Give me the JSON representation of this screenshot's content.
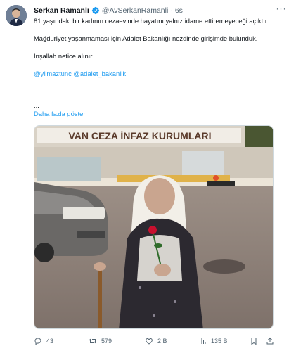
{
  "author": {
    "name": "Serkan Ramanlı",
    "handle": "@AvSerkanRamanli",
    "separator": "·",
    "time": "6s"
  },
  "more_menu": "···",
  "tweet": {
    "paragraph_1": "81 yaşındaki bir kadının cezaevinde hayatını yalnız idame ettiremeyeceği açıktır.",
    "paragraph_2": "Mağduriyet yaşanmaması için Adalet Bakanlığı nezdinde girişimde bulunduk.",
    "paragraph_3": "İnşallah netice alınır.",
    "mentions": "@yilmaztunc @adalet_bakanlik",
    "ellipsis": "...",
    "show_more": "Daha fazla göster"
  },
  "image": {
    "sign_text": "VAN CEZA İNFAZ KURUMLARI"
  },
  "actions": {
    "replies": "43",
    "retweets": "579",
    "likes": "2 B",
    "views": "135 B"
  },
  "colors": {
    "accent": "#1d9bf0",
    "muted": "#536471",
    "text": "#0f1419",
    "verified": "#1d9bf0"
  }
}
